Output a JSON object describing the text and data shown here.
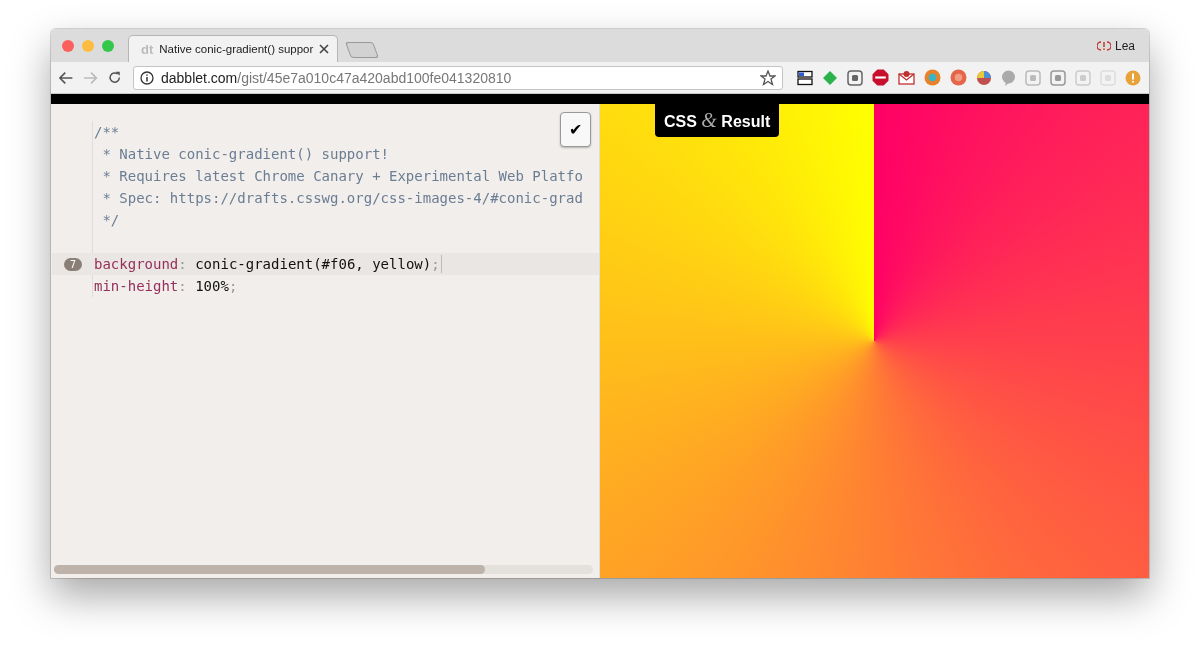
{
  "tab": {
    "title": "Native conic-gradient() suppor",
    "favicon": "dt"
  },
  "profile": {
    "name": "Lea"
  },
  "address": {
    "host": "dabblet.com",
    "path": "/gist/45e7a010c47a420abd100fe041320810"
  },
  "code": [
    {
      "kind": "comment",
      "text": "/**",
      "active": false
    },
    {
      "kind": "comment",
      "text": " * Native conic-gradient() support!",
      "active": false
    },
    {
      "kind": "comment",
      "text": " * Requires latest Chrome Canary + Experimental Web Platfo",
      "active": false
    },
    {
      "kind": "comment",
      "text": " * Spec: https://drafts.csswg.org/css-images-4/#conic-grad",
      "active": false
    },
    {
      "kind": "comment",
      "text": " */",
      "active": false
    },
    {
      "kind": "declaration",
      "gap_before": true,
      "number": "7",
      "property": "background",
      "colon": ":",
      "value": "conic-gradient(#f06, yellow)",
      "semicolon": ";",
      "active": true
    },
    {
      "kind": "declaration",
      "property": "min-height",
      "colon": ":",
      "value": "100%",
      "semicolon": ";",
      "active": false
    }
  ],
  "check_button": {
    "label": "✔"
  },
  "view_toggle": {
    "left": "CSS",
    "joiner": "&",
    "right": "Result"
  }
}
